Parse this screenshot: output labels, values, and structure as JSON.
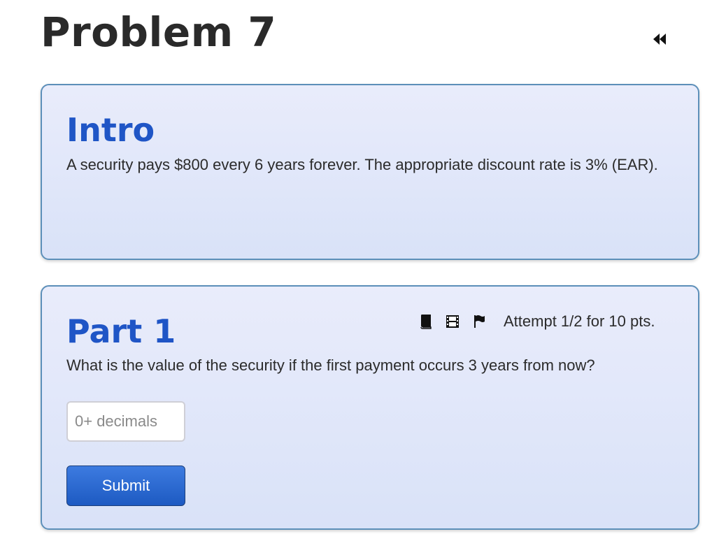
{
  "problem": {
    "title": "Problem 7",
    "collapse_icon": "rewind-icon"
  },
  "intro": {
    "heading": "Intro",
    "text": "A security pays $800 every 6 years forever. The appropriate discount rate is 3% (EAR)."
  },
  "part1": {
    "heading": "Part 1",
    "question": "What is the value of the security if the first payment occurs 3 years from now?",
    "tools": {
      "book_icon": "book-icon",
      "video_icon": "film-icon",
      "flag_icon": "flag-icon"
    },
    "attempt": "Attempt 1/2 for 10 pts.",
    "input": {
      "value": "",
      "placeholder": "0+ decimals"
    },
    "submit_label": "Submit"
  },
  "colors": {
    "heading_blue": "#1f55c6",
    "card_border": "#5c8fb9",
    "card_bg_top": "#e9ecfb",
    "card_bg_bottom": "#d9e2f8",
    "submit_bg": "#1d5ac2"
  }
}
